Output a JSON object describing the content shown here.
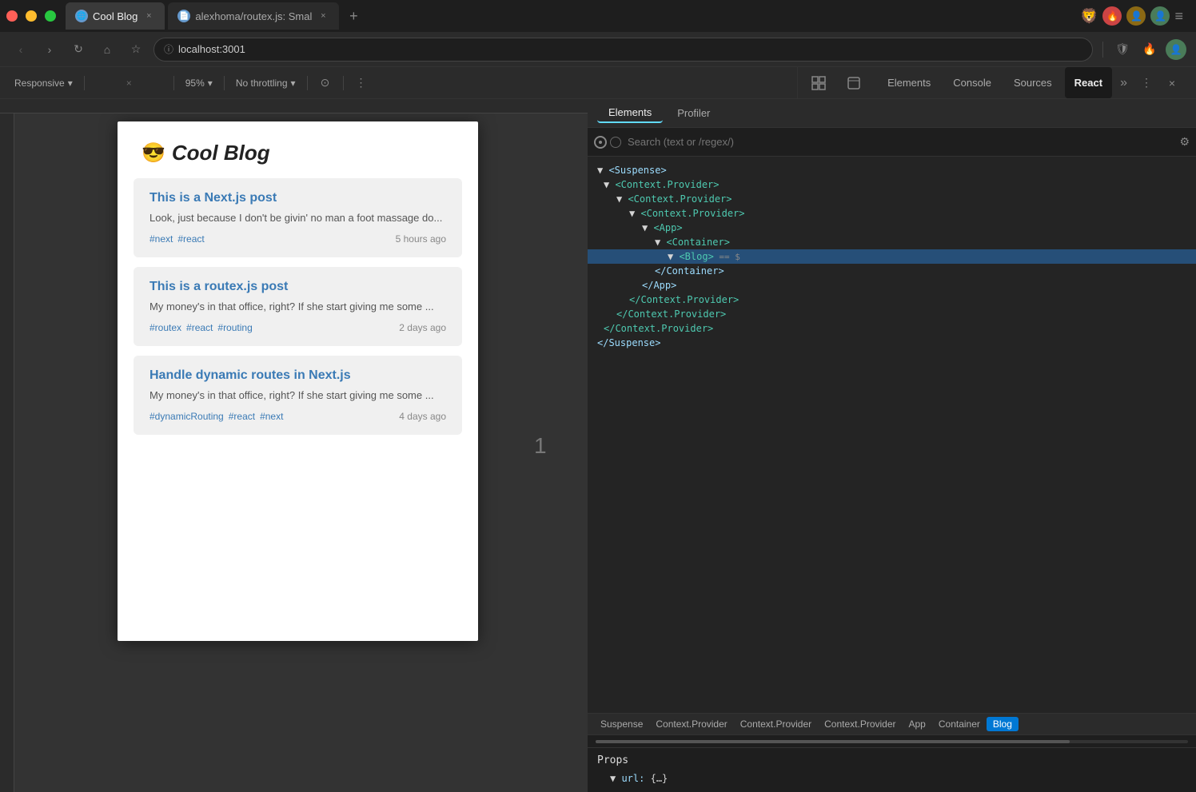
{
  "browser": {
    "tabs": [
      {
        "id": "tab1",
        "favicon": "🌐",
        "title": "Cool Blog",
        "url": "localhost:3001",
        "active": true
      },
      {
        "id": "tab2",
        "favicon": "📄",
        "title": "alexhoma/routex.js: Smal",
        "url": "",
        "active": false
      }
    ],
    "address": "localhost:3001",
    "new_tab_icon": "+"
  },
  "toolbar": {
    "responsive_label": "Responsive",
    "width": "451",
    "height": "585",
    "zoom": "95%",
    "throttle": "No throttling",
    "dropdown_arrow": "▾"
  },
  "devtools": {
    "panels": [
      "Elements",
      "Console",
      "Sources",
      "React"
    ],
    "active_panel": "React",
    "more_icon": "»",
    "subtabs": [
      "Elements",
      "Profiler"
    ],
    "active_subtab": "Elements",
    "search_placeholder": "Search (text or /regex/)"
  },
  "component_tree": [
    {
      "indent": 0,
      "text": "▼ <Suspense>"
    },
    {
      "indent": 1,
      "text": "▼ <Context.Provider>"
    },
    {
      "indent": 2,
      "text": "▼ <Context.Provider>"
    },
    {
      "indent": 3,
      "text": "▼ <Context.Provider>"
    },
    {
      "indent": 4,
      "text": "▼ <App>"
    },
    {
      "indent": 5,
      "text": "▼ <Container>"
    },
    {
      "indent": 6,
      "text": "▼ <Blog>  == $"
    },
    {
      "indent": 5,
      "text": "  </Container>"
    },
    {
      "indent": 4,
      "text": "  </App>"
    },
    {
      "indent": 3,
      "text": "  </Context.Provider>"
    },
    {
      "indent": 2,
      "text": "</Context.Provider>"
    },
    {
      "indent": 1,
      "text": "</Context.Provider>"
    },
    {
      "indent": 0,
      "text": "</Suspense>"
    }
  ],
  "breadcrumbs": [
    {
      "label": "Suspense",
      "active": false
    },
    {
      "label": "Context.Provider",
      "active": false
    },
    {
      "label": "Context.Provider",
      "active": false
    },
    {
      "label": "Context.Provider",
      "active": false
    },
    {
      "label": "App",
      "active": false
    },
    {
      "label": "Container",
      "active": false
    },
    {
      "label": "Blog",
      "active": true
    }
  ],
  "props": {
    "title": "Props",
    "url_key": "url:",
    "url_value": "{…}"
  },
  "page": {
    "title": "Cool Blog",
    "emoji": "😎",
    "posts": [
      {
        "title": "This is a Next.js post",
        "excerpt": "Look, just because I don't be givin' no man a foot massage do...",
        "tags": [
          "#next",
          "#react"
        ],
        "time": "5 hours ago"
      },
      {
        "title": "This is a routex.js post",
        "excerpt": "My money's in that office, right? If she start giving me some ...",
        "tags": [
          "#routex",
          "#react",
          "#routing"
        ],
        "time": "2 days ago"
      },
      {
        "title": "Handle dynamic routes in Next.js",
        "excerpt": "My money's in that office, right? If she start giving me some ...",
        "tags": [
          "#dynamicRouting",
          "#react",
          "#next"
        ],
        "time": "4 days ago"
      }
    ]
  },
  "center_number": "1",
  "icons": {
    "back": "‹",
    "forward": "›",
    "reload": "↻",
    "home": "⌂",
    "bookmark": "☆",
    "info": "ⓘ",
    "close": "×",
    "menu": "≡",
    "search": "🔍",
    "gear": "⚙",
    "fire": "🔥",
    "person": "👤",
    "circle": "●",
    "shield": "🛡",
    "dots": "⋮"
  }
}
